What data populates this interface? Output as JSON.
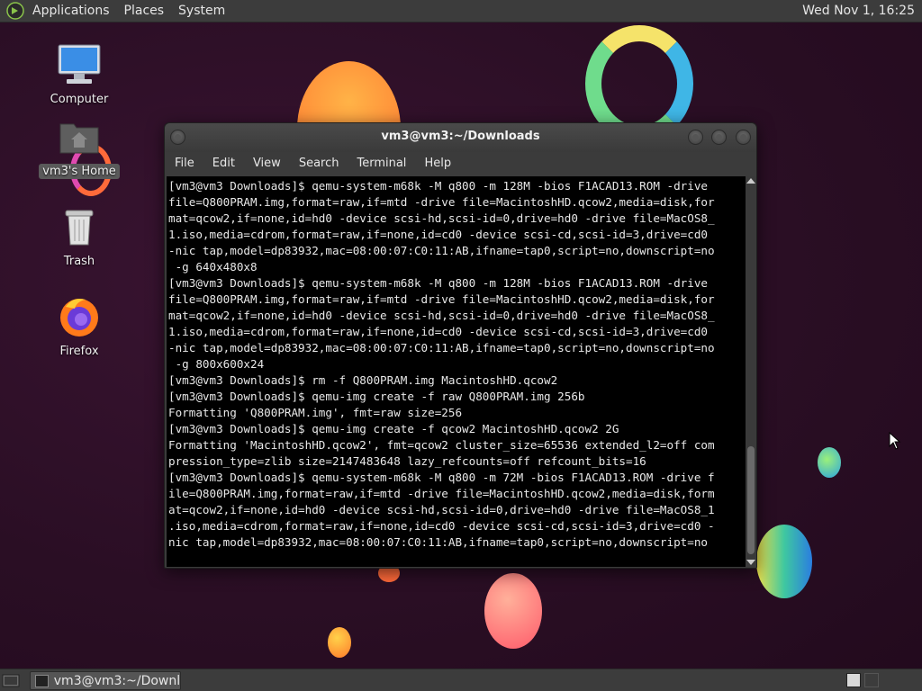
{
  "top_panel": {
    "menus": [
      "Applications",
      "Places",
      "System"
    ],
    "clock": "Wed Nov 1, 16:25",
    "logo_icon": "mate-logo-icon"
  },
  "desktop_icons": [
    {
      "label": "Computer",
      "icon": "computer-icon"
    },
    {
      "label": "vm3's Home",
      "icon": "home-folder-icon",
      "selected": true
    },
    {
      "label": "Trash",
      "icon": "trash-icon"
    },
    {
      "label": "Firefox",
      "icon": "firefox-icon"
    }
  ],
  "terminal": {
    "title": "vm3@vm3:~/Downloads",
    "menu": [
      "File",
      "Edit",
      "View",
      "Search",
      "Terminal",
      "Help"
    ],
    "lines": [
      "[vm3@vm3 Downloads]$ qemu-system-m68k -M q800 -m 128M -bios F1ACAD13.ROM -drive",
      "file=Q800PRAM.img,format=raw,if=mtd -drive file=MacintoshHD.qcow2,media=disk,for",
      "mat=qcow2,if=none,id=hd0 -device scsi-hd,scsi-id=0,drive=hd0 -drive file=MacOS8_",
      "1.iso,media=cdrom,format=raw,if=none,id=cd0 -device scsi-cd,scsi-id=3,drive=cd0",
      "-nic tap,model=dp83932,mac=08:00:07:C0:11:AB,ifname=tap0,script=no,downscript=no",
      " -g 640x480x8",
      "[vm3@vm3 Downloads]$ qemu-system-m68k -M q800 -m 128M -bios F1ACAD13.ROM -drive",
      "file=Q800PRAM.img,format=raw,if=mtd -drive file=MacintoshHD.qcow2,media=disk,for",
      "mat=qcow2,if=none,id=hd0 -device scsi-hd,scsi-id=0,drive=hd0 -drive file=MacOS8_",
      "1.iso,media=cdrom,format=raw,if=none,id=cd0 -device scsi-cd,scsi-id=3,drive=cd0",
      "-nic tap,model=dp83932,mac=08:00:07:C0:11:AB,ifname=tap0,script=no,downscript=no",
      " -g 800x600x24",
      "[vm3@vm3 Downloads]$ rm -f Q800PRAM.img MacintoshHD.qcow2",
      "[vm3@vm3 Downloads]$ qemu-img create -f raw Q800PRAM.img 256b",
      "Formatting 'Q800PRAM.img', fmt=raw size=256",
      "[vm3@vm3 Downloads]$ qemu-img create -f qcow2 MacintoshHD.qcow2 2G",
      "Formatting 'MacintoshHD.qcow2', fmt=qcow2 cluster_size=65536 extended_l2=off com",
      "pression_type=zlib size=2147483648 lazy_refcounts=off refcount_bits=16",
      "[vm3@vm3 Downloads]$ qemu-system-m68k -M q800 -m 72M -bios F1ACAD13.ROM -drive f",
      "ile=Q800PRAM.img,format=raw,if=mtd -drive file=MacintoshHD.qcow2,media=disk,form",
      "at=qcow2,if=none,id=hd0 -device scsi-hd,scsi-id=0,drive=hd0 -drive file=MacOS8_1",
      ".iso,media=cdrom,format=raw,if=none,id=cd0 -device scsi-cd,scsi-id=3,drive=cd0 -",
      "nic tap,model=dp83932,mac=08:00:07:C0:11:AB,ifname=tap0,script=no,downscript=no"
    ]
  },
  "bottom_panel": {
    "task_label": "vm3@vm3:~/Downl..."
  }
}
